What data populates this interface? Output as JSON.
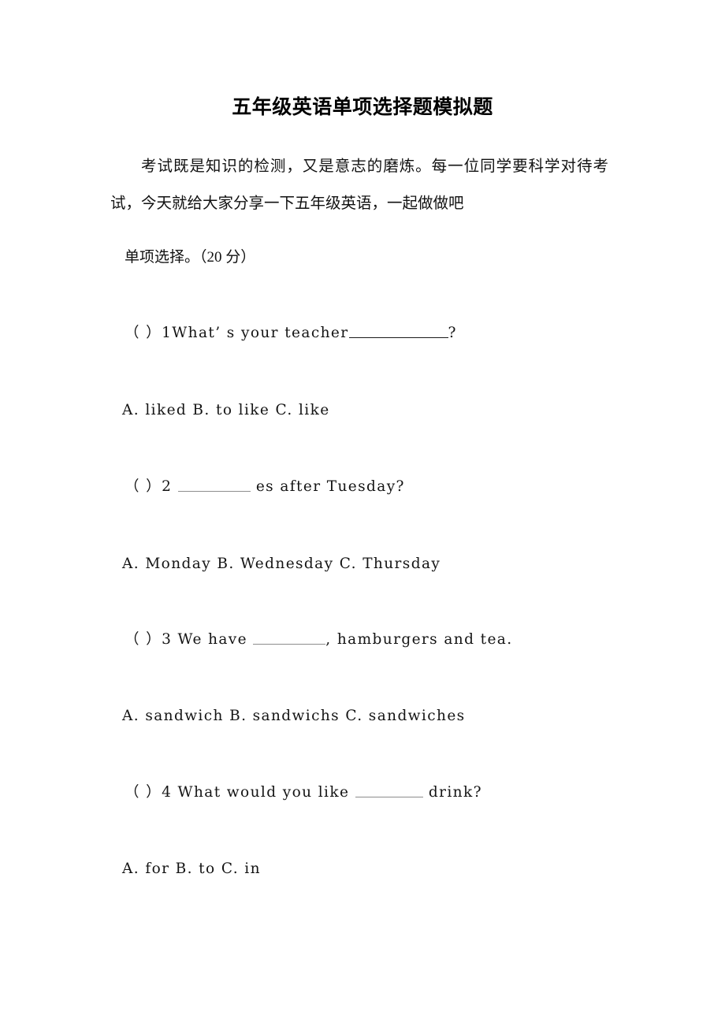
{
  "document": {
    "title": "五年级英语单项选择题模拟题",
    "intro": "考试既是知识的检测，又是意志的磨炼。每一位同学要科学对待考试，今天就给大家分享一下五年级英语，一起做做吧",
    "section_heading": "单项选择。（20 分）",
    "items": [
      {
        "question_prefix": "（ ）1What’ s your teacher",
        "question_suffix": "?",
        "blank_style": "solid-attached",
        "options_line": "A. liked B. to like C. like"
      },
      {
        "question_prefix": "（ ）2 ",
        "question_suffix": " es after Tuesday?",
        "blank_style": "light",
        "options_line": "A. Monday B. Wednesday C. Thursday"
      },
      {
        "question_prefix": "（ ）3 We have ",
        "question_suffix": ", hamburgers and tea.",
        "blank_style": "light",
        "options_line": "A. sandwich B. sandwichs C. sandwiches"
      },
      {
        "question_prefix": "（ ）4 What would you like ",
        "question_suffix": " drink?",
        "blank_style": "light",
        "options_line": "A. for B. to C. in"
      }
    ]
  }
}
